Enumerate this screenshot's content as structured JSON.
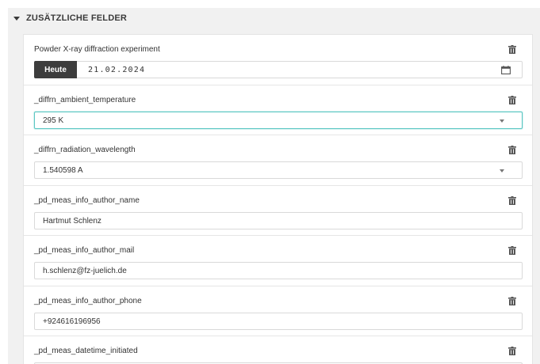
{
  "panel": {
    "title": "ZUSÄTZLICHE FELDER"
  },
  "fields": [
    {
      "label": "Powder X-ray diffraction experiment",
      "type": "date",
      "today_label": "Heute",
      "value": "21.02.2024"
    },
    {
      "label": "_diffrn_ambient_temperature",
      "type": "select",
      "value": "295 K",
      "focused": true
    },
    {
      "label": "_diffrn_radiation_wavelength",
      "type": "select",
      "value": "1.540598 A"
    },
    {
      "label": "_pd_meas_info_author_name",
      "type": "text",
      "value": "Hartmut Schlenz"
    },
    {
      "label": "_pd_meas_info_author_mail",
      "type": "text",
      "value": "h.schlenz@fz-juelich.de"
    },
    {
      "label": "_pd_meas_info_author_phone",
      "type": "text",
      "value": "+924616196956"
    },
    {
      "label": "_pd_meas_datetime_initiated",
      "type": "text",
      "value": ""
    }
  ],
  "icons": {
    "delete": "trash-icon",
    "collapse": "caret-down-icon",
    "calendar": "calendar-icon",
    "dropdown": "chevron-down-icon"
  },
  "colors": {
    "focus_border": "#5cc7c3",
    "today_button": "#3d3d3d"
  }
}
